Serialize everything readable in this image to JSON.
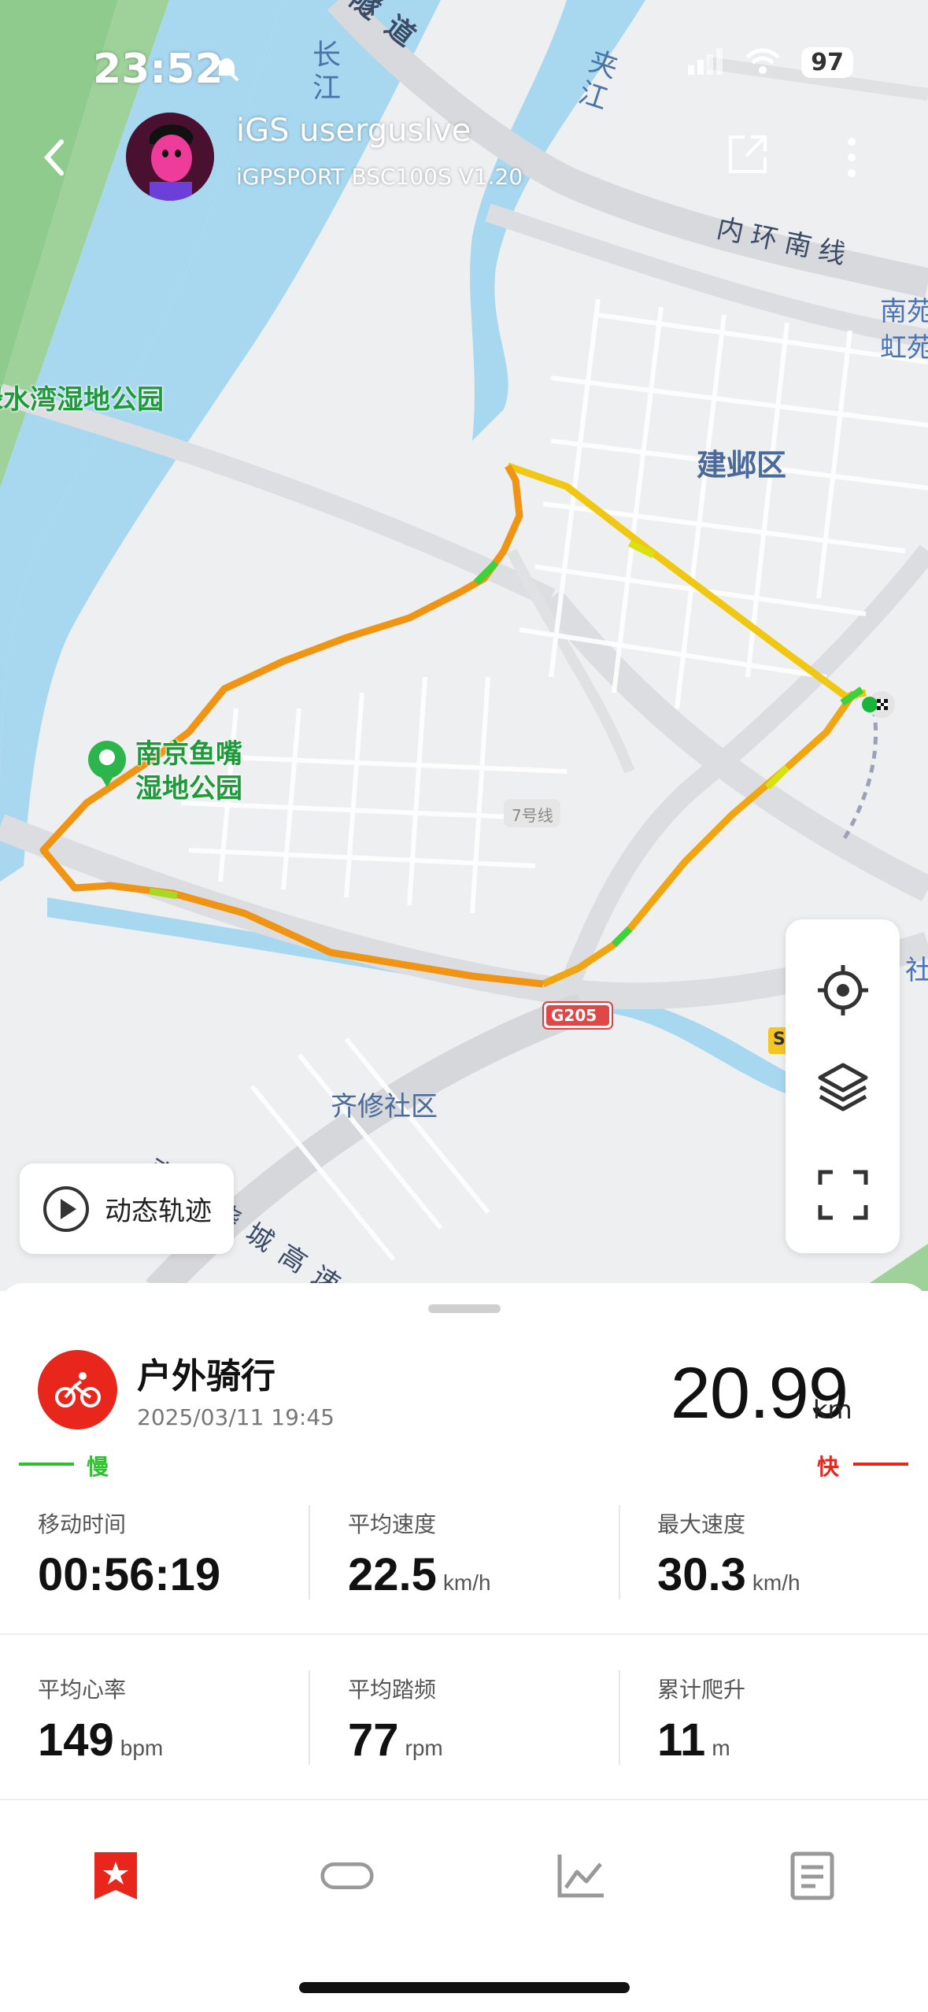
{
  "status_bar": {
    "time": "23:52",
    "battery": "97",
    "icons": [
      "bell-slash-icon",
      "cellular-icon",
      "wifi-icon"
    ]
  },
  "header": {
    "user_name": "iGS usergusIve",
    "device": "iGPSPORT BSC100S V1.20"
  },
  "map": {
    "labels": {
      "tunnel_road": "隧道",
      "changjiang": "长江",
      "jiajiang": "夹江",
      "inner_ring": "内环南线",
      "nanyuan": "南苑",
      "hongyuan": "虹苑",
      "lvshuiwan_park": "绿水湾湿地公园",
      "jianye": "建邺区",
      "yuzui_park_line1": "南京鱼嘴",
      "yuzui_park_line2": "湿地公园",
      "line7": "7号线",
      "g205": "G205",
      "qixiu": "齐修社区",
      "ring_expressway": "南京绕城高速",
      "shang_partial": "社",
      "s_shield": "S"
    },
    "route_speed_colors": {
      "slow": "#2fd12f",
      "mid": "#f2d80f",
      "fast": "#ef8a12"
    }
  },
  "controls": {
    "replay_label": "动态轨迹",
    "icons": [
      "locate-icon",
      "layers-icon",
      "fullscreen-icon"
    ]
  },
  "activity": {
    "type": "户外骑行",
    "datetime": "2025/03/11 19:45",
    "distance": "20.99",
    "distance_unit": "km"
  },
  "speed_legend": {
    "slow": "慢",
    "fast": "快"
  },
  "stats": [
    {
      "label": "移动时间",
      "value": "00:56:19",
      "unit": ""
    },
    {
      "label": "平均速度",
      "value": "22.5",
      "unit": "km/h"
    },
    {
      "label": "最大速度",
      "value": "30.3",
      "unit": "km/h"
    },
    {
      "label": "平均心率",
      "value": "149",
      "unit": "bpm"
    },
    {
      "label": "平均踏频",
      "value": "77",
      "unit": "rpm"
    },
    {
      "label": "累计爬升",
      "value": "11",
      "unit": "m"
    }
  ],
  "tabs": [
    {
      "name": "overview",
      "icon": "star-bookmark-icon",
      "active": true
    },
    {
      "name": "laps",
      "icon": "loop-icon",
      "active": false
    },
    {
      "name": "charts",
      "icon": "line-chart-icon",
      "active": false
    },
    {
      "name": "details",
      "icon": "document-icon",
      "active": false
    }
  ],
  "colors": {
    "accent_red": "#e8261c",
    "slow_green": "#2fbf2f"
  }
}
